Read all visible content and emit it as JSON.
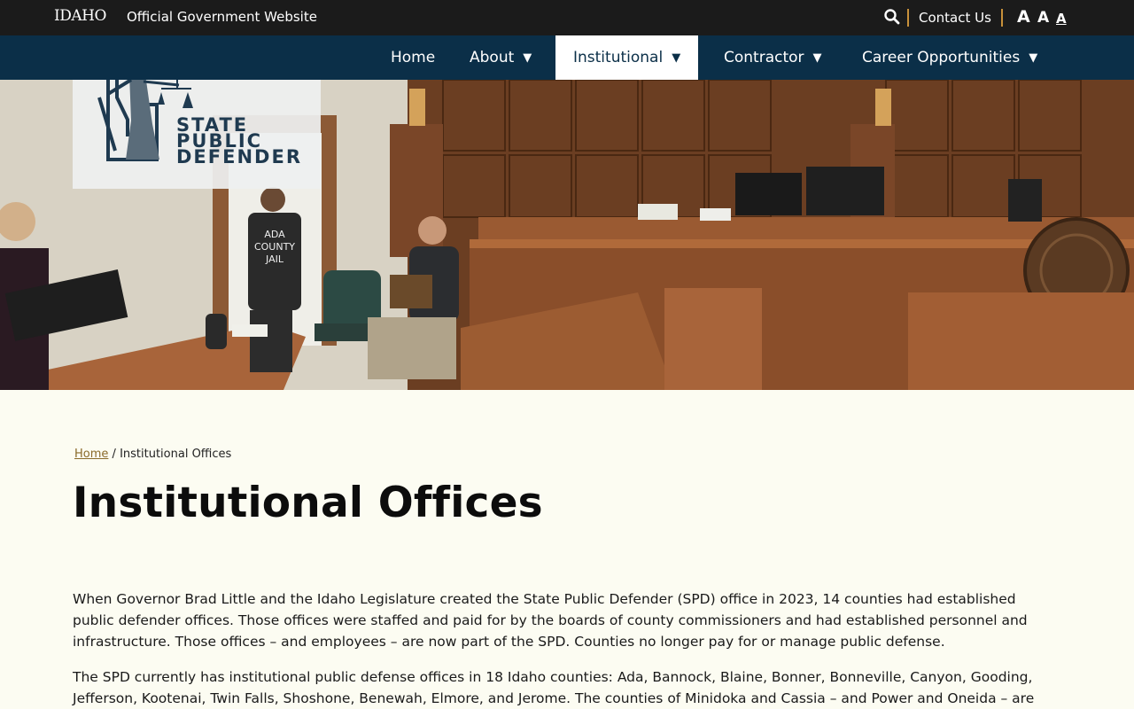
{
  "topbar": {
    "idaho_logo": "IDAHO",
    "official_label": "Official Government Website",
    "contact_label": "Contact Us",
    "font_size_large": "A",
    "font_size_medium": "A",
    "font_size_small": "A"
  },
  "nav": {
    "items": [
      {
        "label": "Home",
        "has_dropdown": false
      },
      {
        "label": "About",
        "has_dropdown": true
      },
      {
        "label": "Institutional",
        "has_dropdown": true,
        "active": true
      },
      {
        "label": "Contractor",
        "has_dropdown": true
      },
      {
        "label": "Career Opportunities",
        "has_dropdown": true
      }
    ],
    "caret": "▼"
  },
  "logo": {
    "line1": "STATE",
    "line2": "PUBLIC",
    "line3": "DEFENDER"
  },
  "breadcrumb": {
    "home": "Home",
    "separator": "/",
    "current": "Institutional Offices"
  },
  "page": {
    "title": "Institutional Offices",
    "paragraph1": "When Governor Brad Little and the Idaho Legislature created the State Public Defender (SPD) office in 2023, 14 counties had established public defender offices. Those offices were staffed and paid for by the boards of county commissioners and had established personnel and infrastructure. Those offices – and employees – are now part of the SPD. Counties no longer pay for or manage public defense.",
    "paragraph2": "The SPD currently has institutional public defense offices in 18 Idaho counties: Ada, Bannock, Blaine, Bonner, Bonneville, Canyon, Gooding, Jefferson, Kootenai, Twin Falls, Shoshone, Benewah, Elmore, and Jerome. The counties of Minidoka and Cassia – and Power and Oneida – are"
  },
  "hero": {
    "shirt_text_1": "ADA",
    "shirt_text_2": "COUNTY",
    "shirt_text_3": "JAIL"
  },
  "colors": {
    "topbar_bg": "#1b1b1b",
    "nav_bg": "#0b2f48",
    "accent_separator": "#c8913a",
    "page_bg": "#fcfcf2",
    "link": "#8a6a2a"
  }
}
